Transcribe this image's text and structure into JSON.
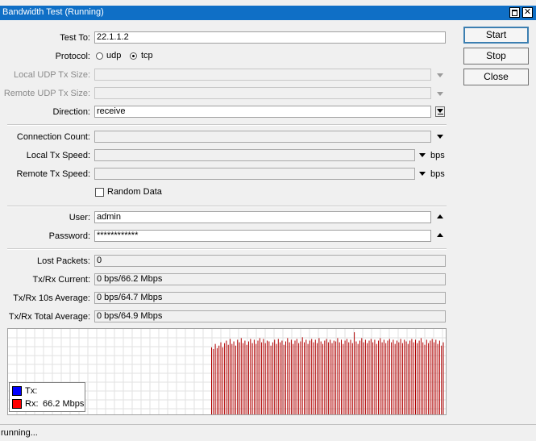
{
  "window": {
    "title": "Bandwidth Test (Running)",
    "close_glyph": "✕"
  },
  "form": {
    "test_to": {
      "label": "Test To:",
      "value": "22.1.1.2"
    },
    "protocol": {
      "label": "Protocol:",
      "options": [
        "udp",
        "tcp"
      ],
      "selected": "tcp"
    },
    "local_udp_tx_size": {
      "label": "Local UDP Tx Size:",
      "value": ""
    },
    "remote_udp_tx_size": {
      "label": "Remote UDP Tx Size:",
      "value": ""
    },
    "direction": {
      "label": "Direction:",
      "value": "receive"
    },
    "connection_count": {
      "label": "Connection Count:",
      "value": ""
    },
    "local_tx_speed": {
      "label": "Local Tx Speed:",
      "value": "",
      "unit": "bps"
    },
    "remote_tx_speed": {
      "label": "Remote Tx Speed:",
      "value": "",
      "unit": "bps"
    },
    "random_data": {
      "label": "Random Data",
      "checked": false
    },
    "user": {
      "label": "User:",
      "value": "admin"
    },
    "password": {
      "label": "Password:",
      "value": "************"
    }
  },
  "results": {
    "lost_packets": {
      "label": "Lost Packets:",
      "value": "0"
    },
    "current": {
      "label": "Tx/Rx Current:",
      "value": "0 bps/66.2 Mbps"
    },
    "avg10s": {
      "label": "Tx/Rx 10s Average:",
      "value": "0 bps/64.7 Mbps"
    },
    "total_avg": {
      "label": "Tx/Rx Total Average:",
      "value": "0 bps/64.9 Mbps"
    }
  },
  "buttons": {
    "start": "Start",
    "stop": "Stop",
    "close": "Close"
  },
  "graph": {
    "tx_label": "Tx:",
    "tx_value": "",
    "rx_label": "Rx:",
    "rx_value": "66.2 Mbps",
    "tx_color": "#0000ff",
    "rx_color": "#ff0000",
    "bar_color": "#b00000",
    "grid_color": "#e2e2e2",
    "rx_levels": [
      0.8,
      0.78,
      0.84,
      0.79,
      0.82,
      0.86,
      0.8,
      0.85,
      0.88,
      0.83,
      0.9,
      0.84,
      0.87,
      0.82,
      0.89,
      0.86,
      0.91,
      0.85,
      0.88,
      0.83,
      0.87,
      0.9,
      0.85,
      0.89,
      0.84,
      0.88,
      0.91,
      0.86,
      0.9,
      0.85,
      0.88,
      0.87,
      0.82,
      0.86,
      0.89,
      0.84,
      0.9,
      0.86,
      0.88,
      0.83,
      0.87,
      0.91,
      0.86,
      0.89,
      0.84,
      0.88,
      0.9,
      0.85,
      0.87,
      0.92,
      0.86,
      0.89,
      0.84,
      0.88,
      0.9,
      0.86,
      0.89,
      0.85,
      0.91,
      0.87,
      0.84,
      0.88,
      0.9,
      0.86,
      0.89,
      0.85,
      0.88,
      0.87,
      0.91,
      0.86,
      0.89,
      0.84,
      0.88,
      0.9,
      0.86,
      0.89,
      0.85,
      0.98,
      0.87,
      0.84,
      0.88,
      0.91,
      0.86,
      0.89,
      0.85,
      0.88,
      0.9,
      0.86,
      0.89,
      0.84,
      0.88,
      0.91,
      0.86,
      0.89,
      0.85,
      0.88,
      0.9,
      0.86,
      0.89,
      0.84,
      0.88,
      0.86,
      0.9,
      0.85,
      0.89,
      0.87,
      0.84,
      0.88,
      0.9,
      0.86,
      0.89,
      0.85,
      0.88,
      0.91,
      0.86,
      0.83,
      0.89,
      0.85,
      0.88,
      0.9,
      0.86,
      0.89,
      0.84,
      0.88,
      0.82,
      0.86
    ]
  },
  "status": {
    "text": "running..."
  }
}
